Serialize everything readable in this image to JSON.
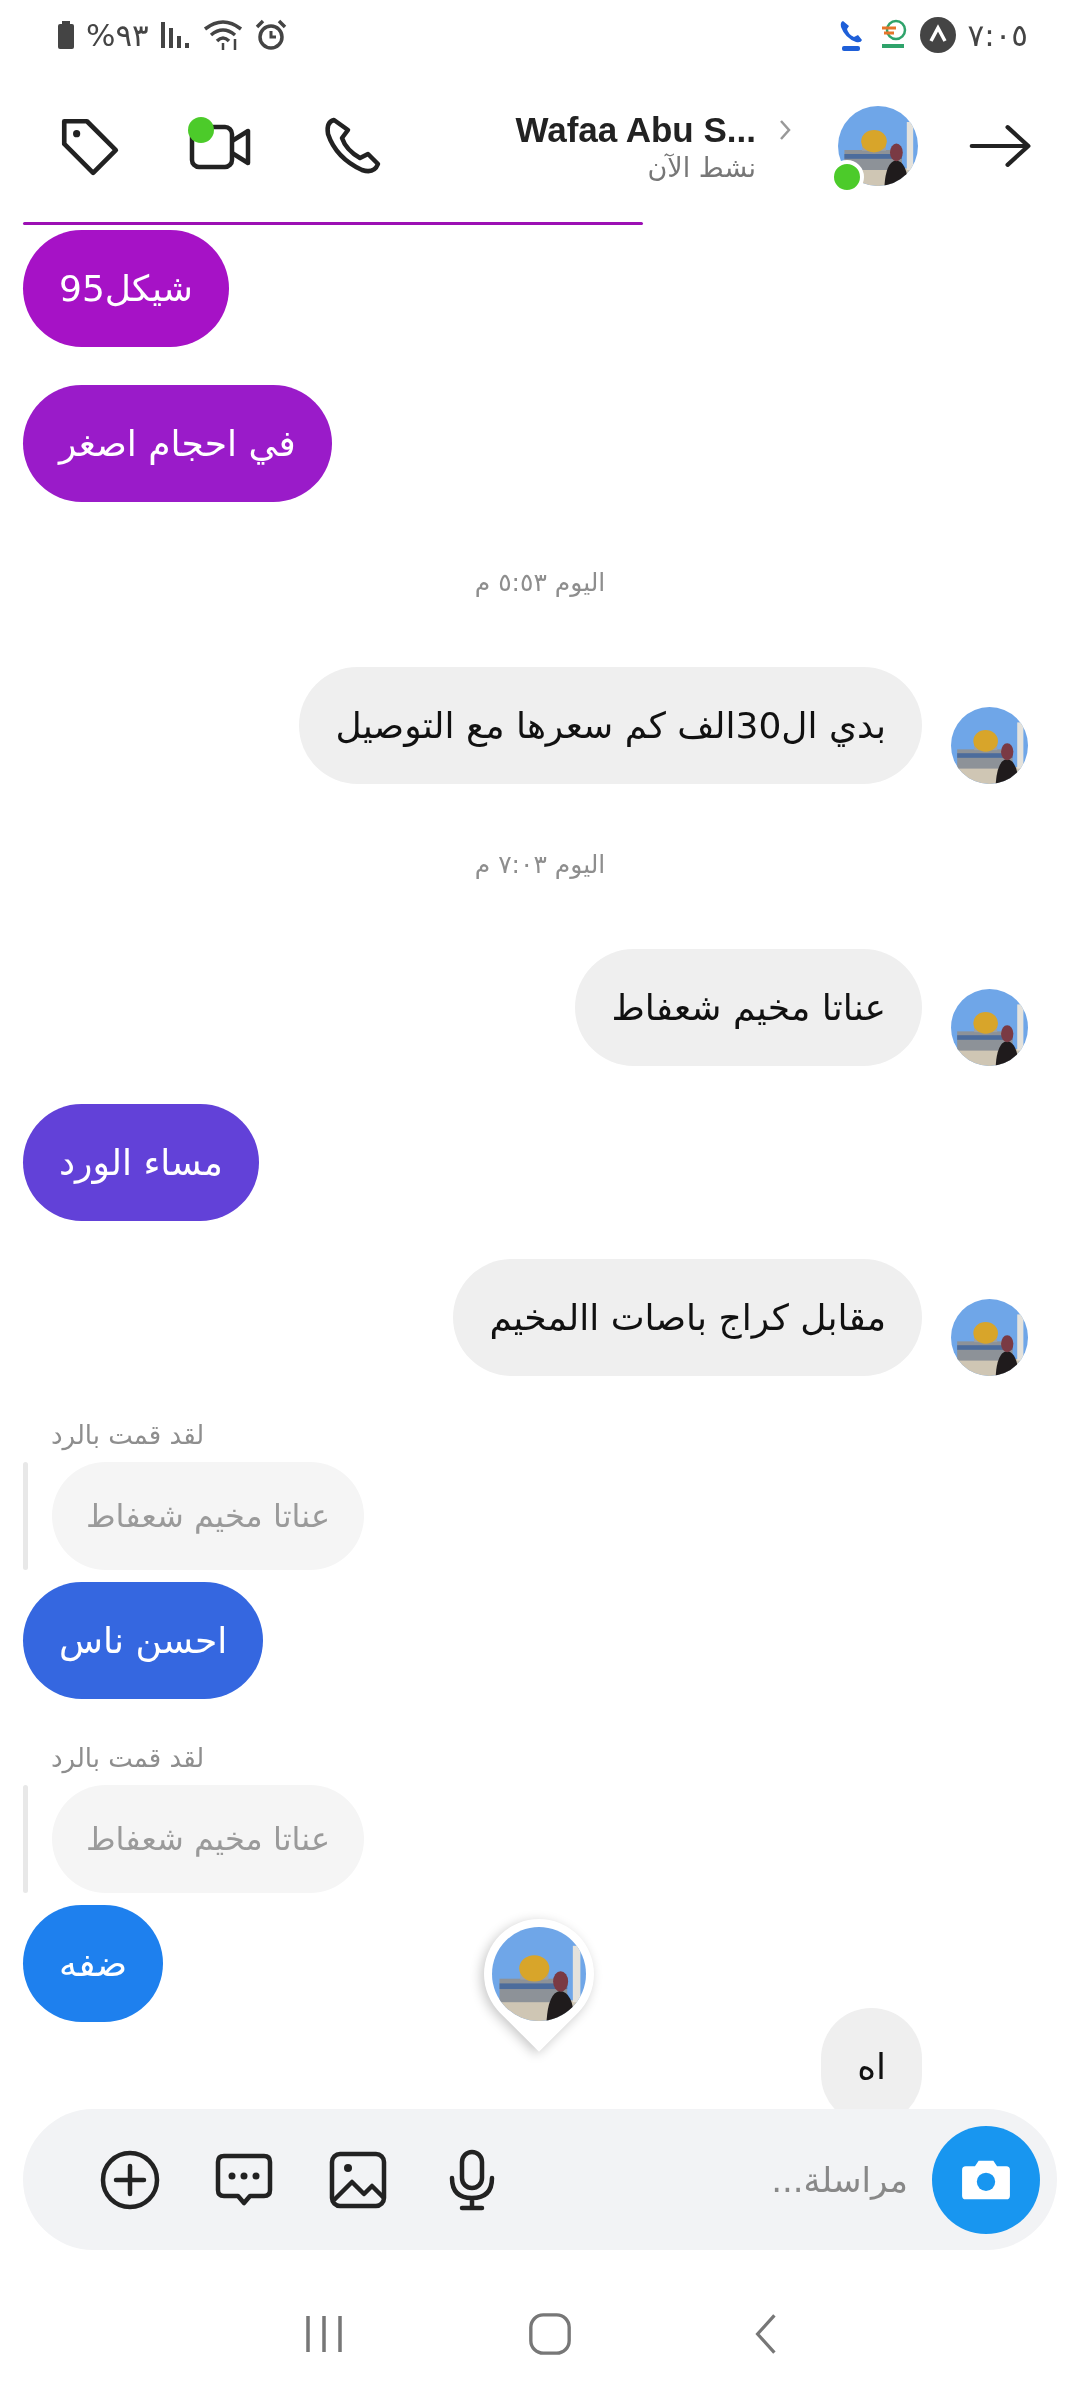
{
  "status_bar": {
    "battery": "%٩٣",
    "time": "٧:٠٥"
  },
  "header": {
    "name": "Wafaa Abu S...",
    "status": "نشط الآن",
    "online": true,
    "video_active": true
  },
  "messages": [
    {
      "kind": "sent",
      "text": "شيكل95",
      "color": "#a612c6"
    },
    {
      "kind": "sent",
      "text": "في احجام اصغر",
      "color": "#9a1bc9"
    },
    {
      "kind": "timestamp",
      "text": "اليوم ٥:٥٣ م"
    },
    {
      "kind": "received",
      "text": "بدي ال30الف كم سعرها مع التوصيل",
      "avatar": true
    },
    {
      "kind": "timestamp",
      "text": "اليوم ٧:٠٣ م"
    },
    {
      "kind": "received",
      "text": "عناتا مخيم شعفاط",
      "avatar": true
    },
    {
      "kind": "sent",
      "text": "مساء الورد",
      "color": "#6241d8"
    },
    {
      "kind": "received",
      "text": "مقابل كراج باصات االمخيم",
      "avatar": true
    },
    {
      "kind": "sent",
      "text": "احسن ناس",
      "color": "#3567e0",
      "reply_label": "لقد قمت بالرد",
      "reply_to": "عناتا مخيم شعفاط"
    },
    {
      "kind": "sent",
      "text": "ضفه",
      "color": "#1e80ee",
      "reply_label": "لقد قمت بالرد",
      "reply_to": "عناتا مخيم شعفاط"
    },
    {
      "kind": "received",
      "text": "اه",
      "avatar": false
    }
  ],
  "composer": {
    "placeholder": "مراسلة..."
  }
}
